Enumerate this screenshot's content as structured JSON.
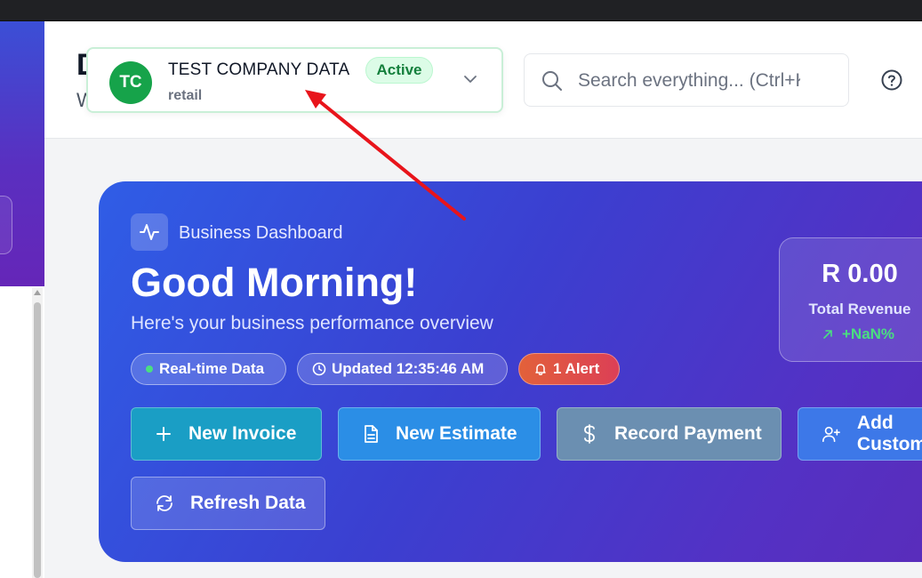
{
  "header": {
    "page_title_fragment": "D",
    "page_subtitle_fragment": "W",
    "company": {
      "initials": "TC",
      "name": "TEST COMPANY DATA",
      "status": "Active",
      "type": "retail"
    },
    "search": {
      "placeholder": "Search everything... (Ctrl+K)"
    }
  },
  "hero": {
    "eyebrow": "Business Dashboard",
    "title": "Good Morning!",
    "subtitle": "Here's your business performance overview",
    "pills": {
      "realtime": "Real-time Data",
      "updated": "Updated 12:35:46 AM",
      "alert": "1 Alert"
    },
    "actions": {
      "new_invoice": "New Invoice",
      "new_estimate": "New Estimate",
      "record_payment": "Record Payment",
      "add_customer": "Add Customer",
      "refresh_data": "Refresh Data"
    },
    "revenue": {
      "value": "R 0.00",
      "label": "Total Revenue",
      "change": "+NaN%"
    }
  },
  "colors": {
    "accent_green": "#16a34a",
    "hero_gradient_start": "#2f5de6",
    "hero_gradient_end": "#5a2cba",
    "annotation_arrow": "#e8141b"
  },
  "icons": [
    "activity-icon",
    "search-icon",
    "help-icon",
    "chevron-down-icon",
    "clock-icon",
    "bell-icon",
    "plus-icon",
    "file-text-icon",
    "dollar-icon",
    "user-plus-icon",
    "refresh-icon",
    "trend-up-icon"
  ]
}
